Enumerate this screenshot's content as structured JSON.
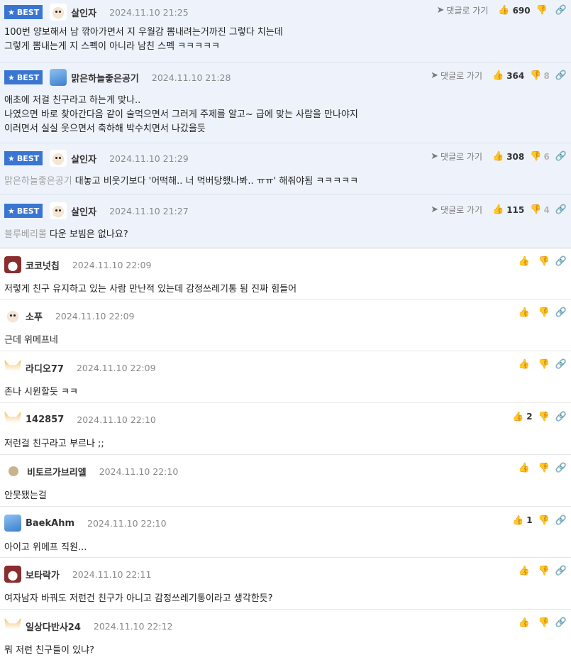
{
  "labels": {
    "best": "BEST",
    "goto_reply": "댓글로 가기"
  },
  "best_comments": [
    {
      "nick": "살인자",
      "date": "2024.11.10 21:25",
      "likes": "690",
      "dislikes": "",
      "lines": [
        "100번 양보해서 남 깎아가면서 지 우월감 뽐내려는거까진 그렇다 치는데",
        "그렇게 뽐내는게 지 스펙이 아니라 남친 스펙 ㅋㅋㅋㅋㅋ"
      ],
      "avatar": "dog"
    },
    {
      "nick": "맑은하늘좋은공기",
      "date": "2024.11.10 21:28",
      "likes": "364",
      "dislikes": "8",
      "lines": [
        "애초에 저걸 친구라고 하는게 맞나..",
        "나였으면 바로 찾아간다음 같이 술먹으면서 그러게 주제를 알고~ 급에 맞는 사람을 만나야지",
        "이러면서 실실 웃으면서 축하해 박수치면서 나갔을듯"
      ],
      "avatar": "sky"
    },
    {
      "nick": "살인자",
      "date": "2024.11.10 21:29",
      "likes": "308",
      "dislikes": "6",
      "quote": "맑은하늘좋은공기",
      "lines": [
        "대놓고 비웃기보다 '어떡해.. 너 먹버당했나봐.. ㅠㅠ' 해줘야됨 ㅋㅋㅋㅋㅋ"
      ],
      "avatar": "dog"
    },
    {
      "nick": "살인자",
      "date": "2024.11.10 21:27",
      "likes": "115",
      "dislikes": "4",
      "quote": "블루베리몰",
      "lines": [
        "다운 보빔은 없나요?"
      ],
      "avatar": "dog"
    }
  ],
  "comments": [
    {
      "nick": "코코넛칩",
      "date": "2024.11.10 22:09",
      "likes": "",
      "text": "저렇게 친구 유지하고 있는 사람 만난적 있는데 감정쓰레기통 됨 진짜 힘들어",
      "avatar": "red"
    },
    {
      "nick": "소푸",
      "date": "2024.11.10 22:09",
      "likes": "",
      "text": "근데 위메프네",
      "avatar": "dog"
    },
    {
      "nick": "라디오77",
      "date": "2024.11.10 22:09",
      "likes": "",
      "text": "존나 시원할듯 ㅋㅋ",
      "avatar": "fox"
    },
    {
      "nick": "142857",
      "date": "2024.11.10 22:10",
      "likes": "2",
      "text": "저런걸 친구라고 부르나 ;;",
      "avatar": "fox"
    },
    {
      "nick": "비토르가브리엘",
      "date": "2024.11.10 22:10",
      "likes": "",
      "text": "안뭇됐는걸",
      "avatar": "ball"
    },
    {
      "nick": "BaekAhm",
      "date": "2024.11.10 22:10",
      "likes": "1",
      "text": "아이고 위메프 직원...",
      "avatar": "sky"
    },
    {
      "nick": "보타락가",
      "date": "2024.11.10 22:11",
      "likes": "",
      "text": "여자남자 바꿔도 저런건 친구가 아니고 감정쓰레기통이라고 생각한듯?",
      "avatar": "red"
    },
    {
      "nick": "일상다반사24",
      "date": "2024.11.10 22:12",
      "likes": "",
      "text": "뭐 저런 친구들이 있냐?",
      "avatar": "fox"
    }
  ],
  "icons": {
    "goto": "send-arrow-icon",
    "like": "thumbs-up-icon",
    "dislike": "thumbs-down-icon",
    "link": "link-icon"
  }
}
